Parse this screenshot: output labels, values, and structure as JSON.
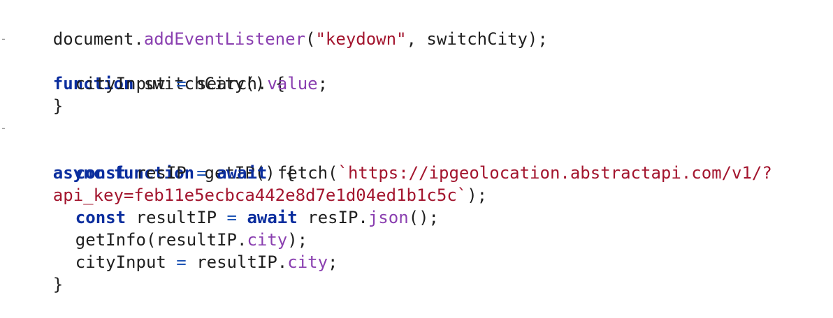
{
  "code": {
    "lines": [
      {
        "tokens": [
          "document.",
          "addEventListener",
          "(",
          "\"keydown\"",
          ", switchCity);"
        ]
      },
      {
        "fold": "-",
        "tokens": [
          "function",
          " switchCity() {"
        ]
      },
      {
        "tokens": [
          "cityInput ",
          "=",
          " search.",
          "value",
          ";"
        ]
      },
      {
        "tokens": [
          "}"
        ]
      },
      {
        "tokens": [
          ""
        ]
      },
      {
        "fold": "-",
        "tokens": [
          "async",
          " ",
          "function",
          " getIP() {"
        ]
      },
      {
        "tokens": [
          "const",
          " resIP ",
          "=",
          " ",
          "await",
          " fetch(",
          "`https://ipgeolocation.abstractapi.com/v1/?"
        ]
      },
      {
        "tokens": [
          "api_key=feb11e5ecbca442e8d7e1d04ed1b1c5c`",
          ");"
        ]
      },
      {
        "tokens": [
          "const",
          " resultIP ",
          "=",
          " ",
          "await",
          " resIP.",
          "json",
          "();"
        ]
      },
      {
        "tokens": [
          "getInfo(resultIP.",
          "city",
          ");"
        ]
      },
      {
        "tokens": [
          "cityInput ",
          "=",
          " resultIP.",
          "city",
          ";"
        ]
      },
      {
        "tokens": [
          "}"
        ]
      }
    ]
  }
}
